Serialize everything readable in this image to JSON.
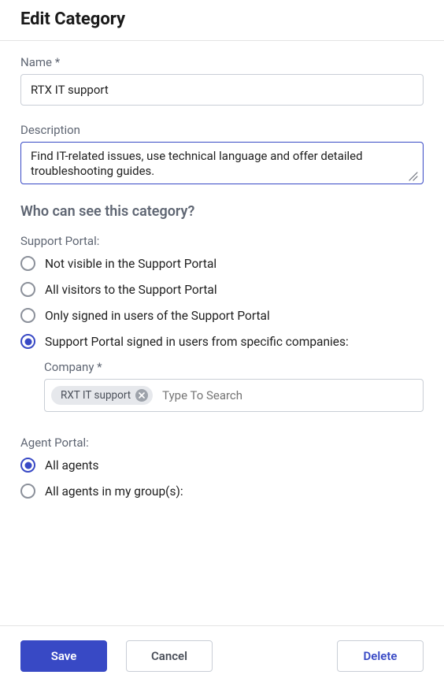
{
  "header": {
    "title": "Edit Category"
  },
  "form": {
    "name_label": "Name *",
    "name_value": "RTX IT support",
    "description_label": "Description",
    "description_value": "Find IT-related issues, use technical language and offer detailed troubleshooting guides."
  },
  "visibility": {
    "section_title": "Who can see this category?",
    "support_portal_label": "Support Portal:",
    "support_options": [
      {
        "label": "Not visible in the Support Portal",
        "checked": false
      },
      {
        "label": "All visitors to the Support Portal",
        "checked": false
      },
      {
        "label": "Only signed in users of the Support Portal",
        "checked": false
      },
      {
        "label": "Support Portal signed in users from specific companies:",
        "checked": true
      }
    ],
    "company_label": "Company *",
    "company_tag": "RXT IT support",
    "company_search_placeholder": "Type To Search",
    "agent_portal_label": "Agent Portal:",
    "agent_options": [
      {
        "label": "All agents",
        "checked": true
      },
      {
        "label": "All agents in my group(s):",
        "checked": false
      }
    ]
  },
  "footer": {
    "save": "Save",
    "cancel": "Cancel",
    "delete": "Delete"
  }
}
